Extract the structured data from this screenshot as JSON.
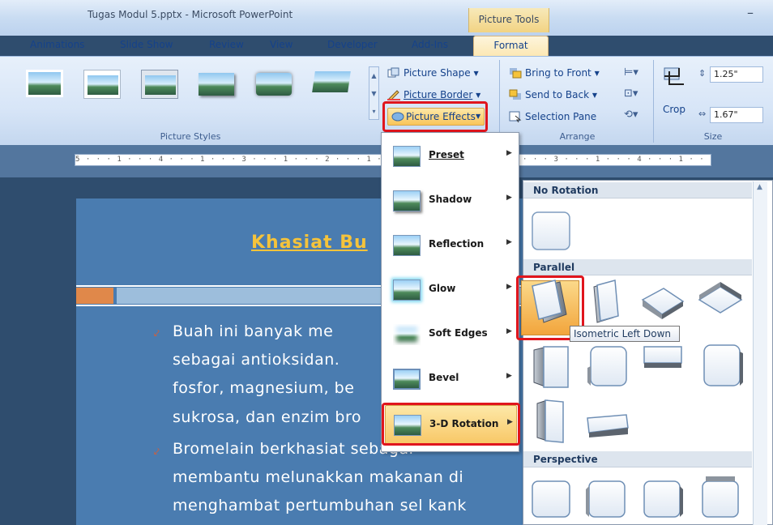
{
  "window": {
    "title": "Tugas Modul 5.pptx - Microsoft PowerPoint",
    "contextual_tab_group": "Picture Tools",
    "minimize_glyph": "–"
  },
  "tabs": [
    "Animations",
    "Slide Show",
    "Review",
    "View",
    "Developer",
    "Add-Ins",
    "Format"
  ],
  "ribbon": {
    "picture_styles_label": "Picture Styles",
    "arrange_label": "Arrange",
    "size_label": "Size",
    "picture_shape": "Picture Shape",
    "picture_border": "Picture Border",
    "picture_effects": "Picture Effects",
    "bring_to_front": "Bring to Front",
    "send_to_back": "Send to Back",
    "selection_pane": "Selection Pane",
    "crop": "Crop",
    "height_value": "1.25\"",
    "width_value": "1.67\""
  },
  "ruler_text": "5 · · · 1 · · · 4 · · · 1 · · · 3 · · · 1 · · · 2 · · · 1 · · · 1 · · · · · 2 · · · 1 · · · 3 · · · 1 · · · 4 · · · 1 · · ·",
  "slide": {
    "title": "Khasiat Bu",
    "lines": [
      "Buah  ini  banyak  me",
      "sebagai  antioksidan.",
      "fosfor, magnesium, be",
      "sukrosa, dan enzim bro",
      "Bromelain       berkhasiat        sebagai",
      "membantu melunakkan makanan di",
      "menghambat  pertumbuhan  sel  kank"
    ],
    "bullet_glyph": "⤦"
  },
  "picture_effects_menu": [
    {
      "label": "Preset",
      "mnemonic": "P"
    },
    {
      "label": "Shadow",
      "mnemonic": "S"
    },
    {
      "label": "Reflection",
      "mnemonic": "R"
    },
    {
      "label": "Glow",
      "mnemonic": "G"
    },
    {
      "label": "Soft Edges",
      "mnemonic": "E"
    },
    {
      "label": "Bevel",
      "mnemonic": "B"
    },
    {
      "label": "3-D Rotation",
      "mnemonic": "D"
    }
  ],
  "rotation_gallery": {
    "sections": [
      "No Rotation",
      "Parallel",
      "Perspective"
    ],
    "tooltip": "Isometric Left Down"
  },
  "colors": {
    "accent_highlight": "#e0151d",
    "slide_bg": "#4a7cb0",
    "slide_title": "#f5c33b",
    "menu_active": "#f8c867"
  }
}
